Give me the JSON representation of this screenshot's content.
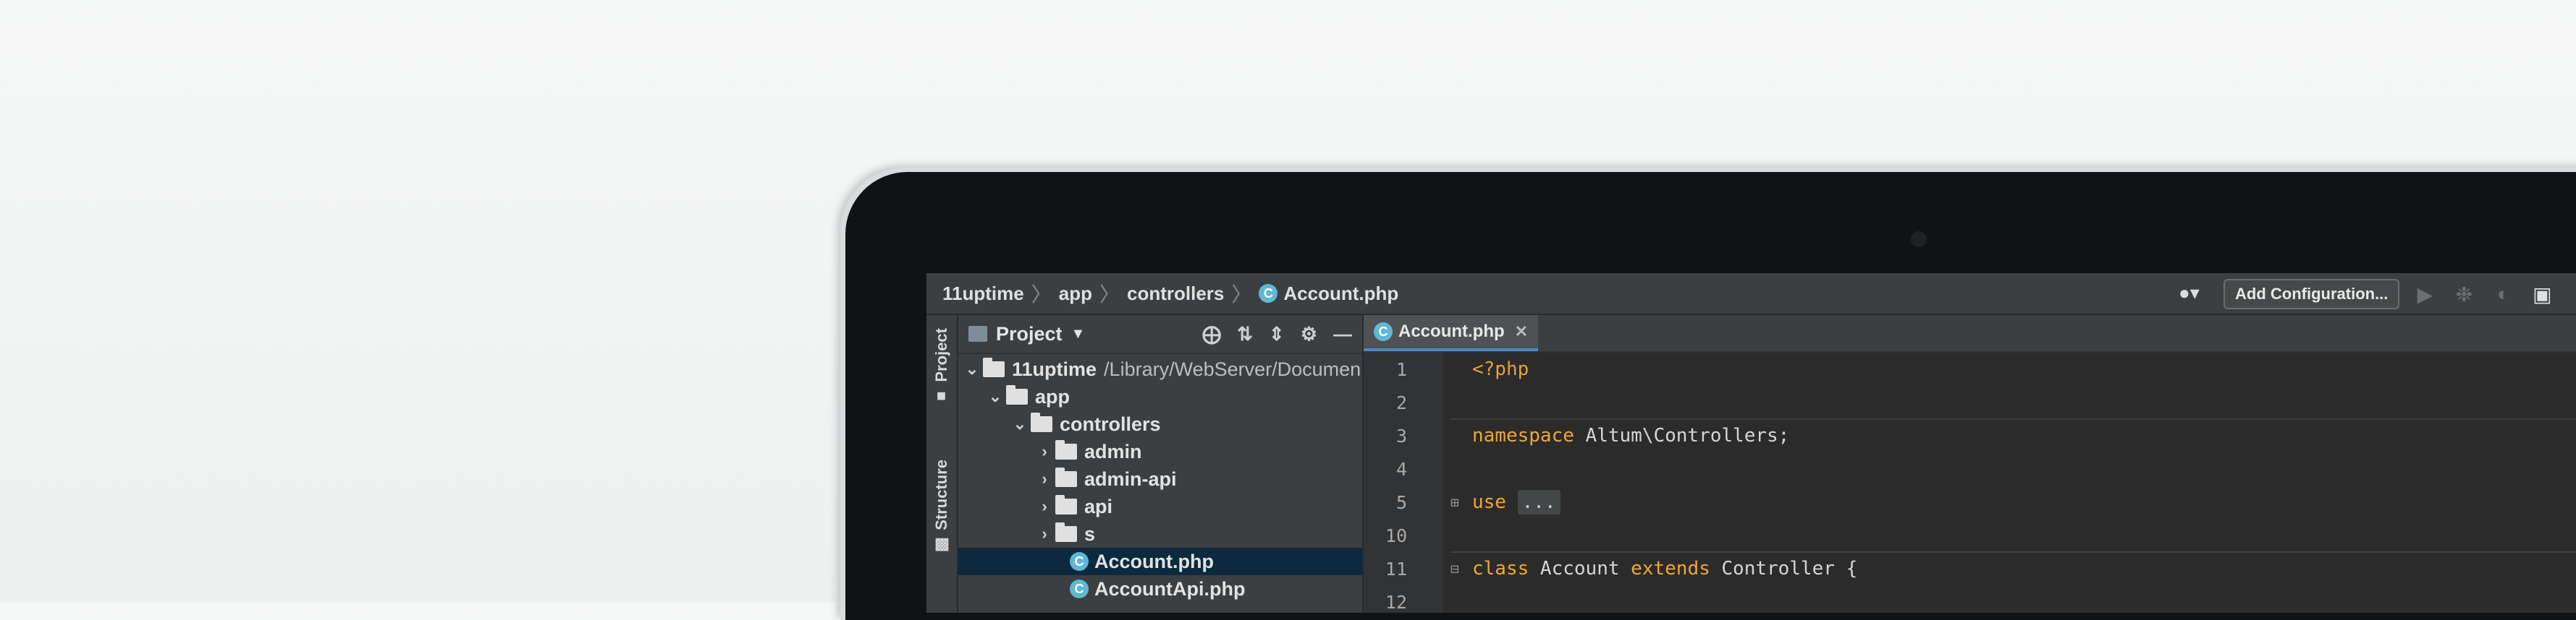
{
  "breadcrumb": {
    "items": [
      "11uptime",
      "app",
      "controllers",
      "Account.php"
    ],
    "file_icon_letter": "C"
  },
  "toolbar": {
    "add_config_label": "Add Configuration...",
    "icons": [
      "user-icon",
      "run-icon",
      "debug-icon",
      "coverage-icon",
      "profile-icon"
    ]
  },
  "tool_stripe": {
    "project_label": "Project",
    "structure_label": "Structure"
  },
  "project_panel": {
    "title": "Project",
    "tree": [
      {
        "label": "11uptime",
        "path": "/Library/WebServer/Documen",
        "type": "folder",
        "expanded": true
      },
      {
        "label": "app",
        "type": "folder",
        "expanded": true
      },
      {
        "label": "controllers",
        "type": "folder",
        "expanded": true
      },
      {
        "label": "admin",
        "type": "folder",
        "expanded": false
      },
      {
        "label": "admin-api",
        "type": "folder",
        "expanded": false
      },
      {
        "label": "api",
        "type": "folder",
        "expanded": false
      },
      {
        "label": "s",
        "type": "folder",
        "expanded": false
      },
      {
        "label": "Account.php",
        "type": "php-class",
        "selected": true
      },
      {
        "label": "AccountApi.php",
        "type": "php-class"
      }
    ]
  },
  "editor": {
    "active_tab": "Account.php",
    "lines": [
      {
        "num": "1",
        "code": "<?php"
      },
      {
        "num": "2",
        "code": ""
      },
      {
        "num": "3",
        "code_kw": "namespace",
        "code_rest": " Altum\\Controllers;"
      },
      {
        "num": "4",
        "code": ""
      },
      {
        "num": "5",
        "code_kw": "use",
        "code_rest": " ",
        "folded": "..."
      },
      {
        "num": "10",
        "code": ""
      },
      {
        "num": "11",
        "code_kw": "class",
        "code_rest": " Account ",
        "code_kw2": "extends",
        "code_rest2": " Controller {"
      },
      {
        "num": "12",
        "code": ""
      }
    ]
  },
  "colors": {
    "keyword": "#f0a732",
    "selection": "#0d293e",
    "tab_underline": "#4a88c7"
  }
}
